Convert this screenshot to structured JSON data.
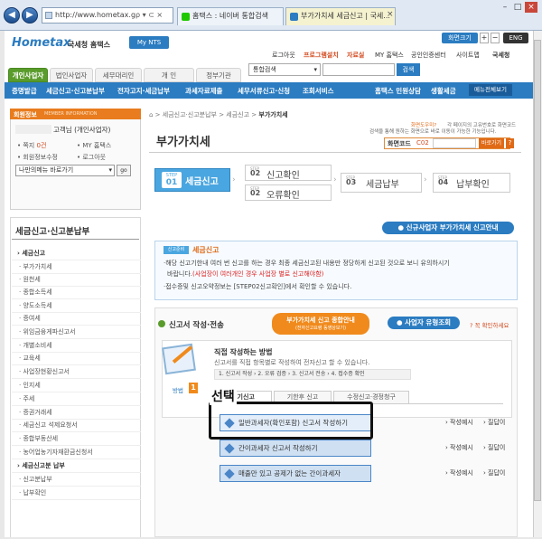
{
  "browser": {
    "url": "http://www.hometax.go.kr/ef",
    "address_controls": "ρ ▾ ⊂ ×",
    "tabs": [
      "홈택스 : 네이버 통합검색",
      "부가가치세 세금신고 | 국세..."
    ],
    "close": "×",
    "window_controls": [
      "–",
      "□",
      "×"
    ]
  },
  "header": {
    "logo_text": "Hometax",
    "logo_sub": "국세청 홈택스",
    "mynts": "My NTS",
    "zoom_label": "화면크기",
    "zoom_plus": "+",
    "zoom_minus": "−",
    "lang": "ENG",
    "toplinks": [
      "로그아웃",
      "프로그램설치",
      "자료실",
      "MY 홈택스",
      "공인인증센터",
      "사이트맵"
    ],
    "gov_badge": "국세청",
    "main_tabs": [
      "개인사업자",
      "법인사업자",
      "세무대리인",
      "개 인",
      "정부기관"
    ],
    "search_scope": "통합검색",
    "search_button": "검색",
    "blue_nav": [
      "증명발급",
      "세금신고·신고분납부",
      "전자고지·세금납부",
      "과세자료제출",
      "세무서류신고·신청",
      "조회서비스"
    ],
    "right_nav": [
      "홈택스 민원상담",
      "생활세금"
    ],
    "all_menu": "메뉴전체보기"
  },
  "sidebar": {
    "member_title": "회원정보",
    "member_title_en": "MEMBER INFORMATION",
    "member_name": "고객님 (개인사업자)",
    "stats": [
      {
        "label": "쪽지",
        "value": "0건"
      },
      {
        "label": "MY 홈택스",
        "value": ""
      },
      {
        "label": "회원정보수정",
        "value": ""
      },
      {
        "label": "로그아웃",
        "value": ""
      }
    ],
    "my_menu_placeholder": "나만의메뉴 바로가기",
    "go": "go",
    "section_title": "세금신고·신고분납부",
    "items": [
      "세금신고",
      "부가가치세",
      "원천세",
      "종합소득세",
      "양도소득세",
      "증여세",
      "위임금융게파신고서",
      "개별소비세",
      "교육세",
      "사업장현황신고서",
      "인지세",
      "주세",
      "증권거래세",
      "세금신고 석제요청서",
      "종합부동산세",
      "농어업농기자재환금신청서",
      "세금신고분 납부",
      "신고분납부",
      "납부확인"
    ]
  },
  "breadcrumb": [
    "⌂",
    "세금신고·신고분납부",
    "세금신고",
    "부가가치세"
  ],
  "page_title": "부가가치세",
  "notice": {
    "link": "화면도우미?",
    "text1": "각 페이지의 고유번호로 화면코드",
    "text2": "검색을 통해 원하는 화면으로 바로 이동이 가능한 기능입니다."
  },
  "screen_code": {
    "label": "화면코드",
    "prefix": "C02",
    "go": "바로가기",
    "help": "?"
  },
  "steps": [
    {
      "no": "01",
      "label": "세금신고"
    },
    {
      "no": "02",
      "label": "신고확인"
    },
    {
      "no": "02",
      "label": "오류확인"
    },
    {
      "no": "03",
      "label": "세금납부"
    },
    {
      "no": "04",
      "label": "납부확인"
    }
  ],
  "steps_prefix": "STEP",
  "new_biz_button": "신규사업자 부가가치세 신고안내",
  "info": {
    "badge": "신고준비",
    "heading": "세금신고",
    "line1": "·해당 신고기한내 여러 번 신고를 하는 경우 최종 세금신고된 내용만 정당하게 신고된 것으로 보니 유의하시기",
    "line2a": "바랍니다.",
    "line2b": "(사업장이 여러개인 경우 사업장 별로 신고해야함)",
    "line3": "·접수증및 신고오약정보는 [STEP02신고확인]에서 확인할 수 있습니다."
  },
  "write": {
    "heading": "신고서 작성·전송",
    "guide_button": "부가가치세 신고 종합안내",
    "guide_sub": "(전자신고요령 동영상보기)",
    "biz_type_button": "사업자 유형조회",
    "check_link": "꼭 확인하세요"
  },
  "direct": {
    "title": "직접 작성하는 방법",
    "desc": "신고서를 직접 항목별로 작성하여 전자신고 할 수 있습니다.",
    "flow": [
      "1. 신고서 작성",
      "2. 오류 검증",
      "3. 신고서 전송",
      "4. 접수증 확인"
    ],
    "method_label": "방법",
    "method_no": "1"
  },
  "subtabs": [
    "정기신고",
    "기한후 신고",
    "수정신고·경정청구"
  ],
  "options": [
    {
      "label": "일반과세자(확인포함) 신고서 작성하기",
      "example": "작성예시",
      "ask": "질답이"
    },
    {
      "label": "간이과세자 신고서 작성하기",
      "example": "작성예시",
      "ask": "질답이"
    },
    {
      "label": "매출만 있고 공제가 없는 간이과세자",
      "example": "작성예시",
      "ask": "질답이"
    }
  ],
  "annotation": {
    "label": "선택"
  },
  "colors": {
    "accent_blue": "#2b7cc1",
    "green": "#5a9c2c",
    "orange": "#f08a1c",
    "step_active": "#4aa6e0"
  }
}
